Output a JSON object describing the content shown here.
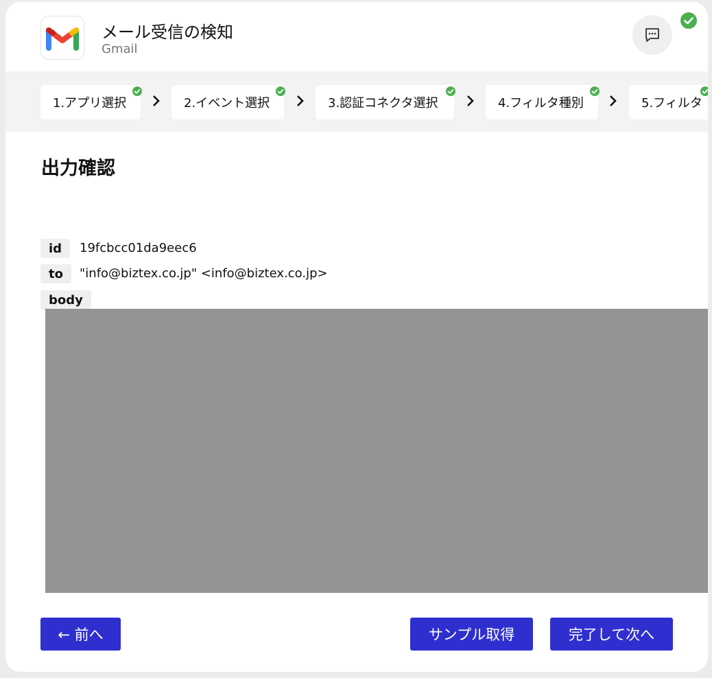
{
  "header": {
    "title": "メール受信の検知",
    "subtitle": "Gmail",
    "app_icon": "gmail-logo",
    "chat_icon": "chat-bubble-icon",
    "status_icon": "check-circle-icon"
  },
  "steps": [
    {
      "label": "1.アプリ選択",
      "done": true
    },
    {
      "label": "2.イベント選択",
      "done": true
    },
    {
      "label": "3.認証コネクタ選択",
      "done": true
    },
    {
      "label": "4.フィルタ種別",
      "done": true
    },
    {
      "label": "5.フィルタ",
      "done": true
    }
  ],
  "section": {
    "title": "出力確認"
  },
  "fields": {
    "id": {
      "label": "id",
      "value": "19fcbcc01da9eec6"
    },
    "to": {
      "label": "to",
      "value": "\"info@biztex.co.jp\" <info@biztex.co.jp>"
    },
    "body": {
      "label": "body"
    }
  },
  "buttons": {
    "prev": "← 前へ",
    "sample": "サンプル取得",
    "next": "完了して次へ"
  },
  "colors": {
    "accent": "#2f2fcf",
    "success": "#4caf50",
    "redacted": "#949494"
  }
}
